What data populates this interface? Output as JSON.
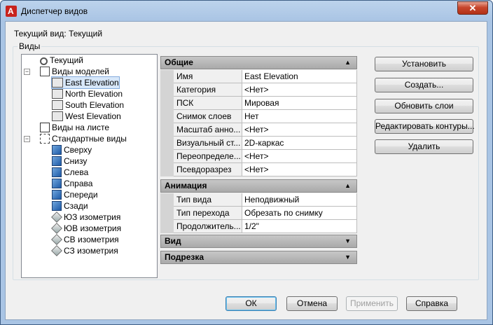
{
  "window": {
    "title": "Диспетчер видов",
    "close": "✕"
  },
  "current_view": "Текущий вид: Текущий",
  "group_label": "Виды",
  "tree": {
    "current": "Текущий",
    "model_views": "Виды моделей",
    "model_items": [
      "East Elevation",
      "North Elevation",
      "South Elevation",
      "West Elevation"
    ],
    "layout_views": "Виды на листе",
    "preset_views": "Стандартные виды",
    "preset_items": [
      "Сверху",
      "Снизу",
      "Слева",
      "Справа",
      "Спереди",
      "Сзади",
      "ЮЗ изометрия",
      "ЮВ изометрия",
      "СВ изометрия",
      "СЗ изометрия"
    ]
  },
  "sections": {
    "general": "Общие",
    "animation": "Анимация",
    "view": "Вид",
    "clipping": "Подрезка"
  },
  "general_props": [
    {
      "name": "Имя",
      "value": "East Elevation"
    },
    {
      "name": "Категория",
      "value": "<Нет>"
    },
    {
      "name": "ПСК",
      "value": "Мировая"
    },
    {
      "name": "Снимок слоев",
      "value": "Нет"
    },
    {
      "name": "Масштаб анно...",
      "value": "<Нет>"
    },
    {
      "name": "Визуальный ст...",
      "value": "2D-каркас"
    },
    {
      "name": "Переопределе...",
      "value": "<Нет>"
    },
    {
      "name": "Псевдоразрез",
      "value": "<Нет>"
    }
  ],
  "animation_props": [
    {
      "name": "Тип вида",
      "value": "Неподвижный"
    },
    {
      "name": "Тип перехода",
      "value": "Обрезать по снимку"
    },
    {
      "name": "Продолжитель...",
      "value": "1/2\""
    }
  ],
  "buttons": {
    "set_current": "Установить",
    "new": "Создать...",
    "update_layers": "Обновить слои",
    "edit_boundaries": "Редактировать контуры...",
    "delete": "Удалить",
    "ok": "ОК",
    "cancel": "Отмена",
    "apply": "Применить",
    "help": "Справка"
  },
  "icons": {
    "up": "▲",
    "down": "▼"
  }
}
